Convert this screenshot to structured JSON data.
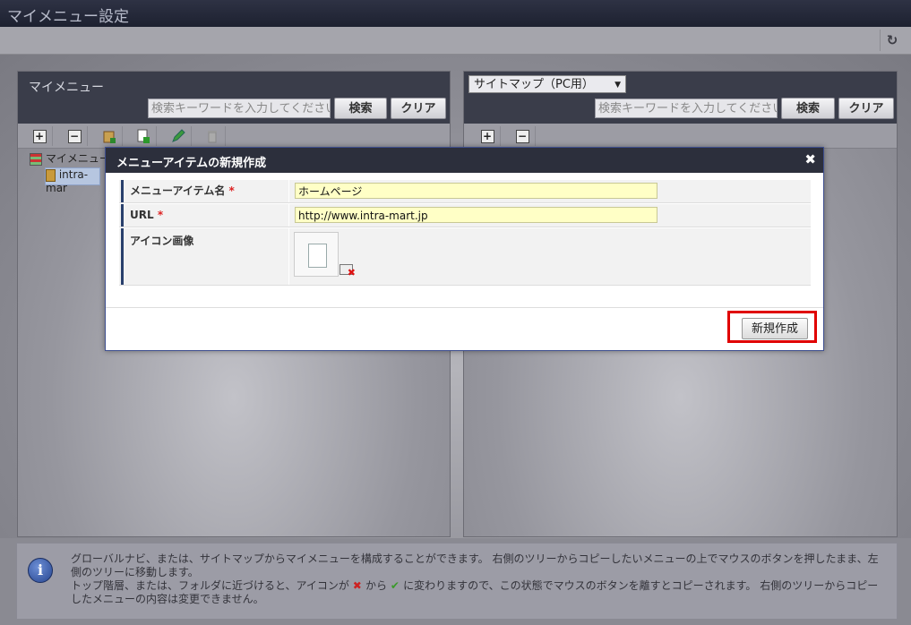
{
  "title": "マイメニュー設定",
  "left_panel": {
    "title": "マイメニュー",
    "search_placeholder": "検索キーワードを入力してください",
    "search_button": "検索",
    "clear_button": "クリア",
    "tree_root": "マイメニュー",
    "tree_item": "intra-mar"
  },
  "right_panel": {
    "select_value": "サイトマップ（PC用）",
    "search_placeholder": "検索キーワードを入力してください",
    "search_button": "検索",
    "clear_button": "クリア"
  },
  "dialog": {
    "title": "メニューアイテムの新規作成",
    "close": "✖",
    "fields": [
      {
        "label": "メニューアイテム名",
        "required": "*",
        "value": "ホームページ"
      },
      {
        "label": "URL",
        "required": "*",
        "value": "http://www.intra-mart.jp"
      },
      {
        "label": "アイコン画像"
      }
    ],
    "create_button": "新規作成"
  },
  "info": {
    "line1": "グローバルナビ、または、サイトマップからマイメニューを構成することができます。 右側のツリーからコピーしたいメニューの上でマウスのボタンを押したまま、左側のツリーに移動します。",
    "line2a": "トップ階層、または、フォルダに近づけると、アイコンが",
    "line2b": "から",
    "line2c": "に変わりますので、この状態でマウスのボタンを離すとコピーされます。 右側のツリーからコピーしたメニューの内容は変更できません。"
  }
}
